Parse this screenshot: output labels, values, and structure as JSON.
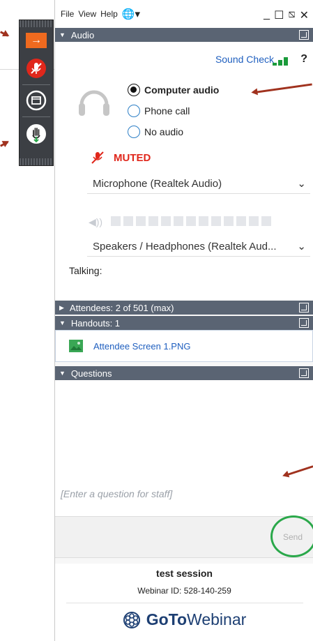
{
  "menu": {
    "file": "File",
    "view": "View",
    "help": "Help"
  },
  "window_controls": {
    "minimize": "_",
    "maximize": "☐",
    "popout": "⧅",
    "close": "✕"
  },
  "audio": {
    "header": "Audio",
    "sound_check": "Sound Check",
    "help_mark": "?",
    "options": [
      {
        "label": "Computer audio",
        "selected": true
      },
      {
        "label": "Phone call",
        "selected": false
      },
      {
        "label": "No audio",
        "selected": false
      }
    ],
    "muted_label": "MUTED",
    "microphone": "Microphone (Realtek Audio)",
    "speakers": "Speakers / Headphones (Realtek Aud...",
    "talking_label": "Talking:"
  },
  "attendees": {
    "header": "Attendees:  2 of 501 (max)"
  },
  "handouts": {
    "header": "Handouts: 1",
    "items": [
      {
        "name": "Attendee Screen 1.PNG"
      }
    ]
  },
  "questions": {
    "header": "Questions",
    "placeholder": "[Enter a question for staff]",
    "send_label": "Send"
  },
  "footer": {
    "session_name": "test session",
    "webinar_id": "Webinar ID: 528-140-259",
    "brand_goto": "GoTo",
    "brand_webinar": "Webinar"
  },
  "colors": {
    "header_bg": "#5a6473",
    "link": "#1f5fbf",
    "muted_red": "#e0271b",
    "annotation_arrow": "#a0321e",
    "send_highlight": "#2aa84a"
  }
}
